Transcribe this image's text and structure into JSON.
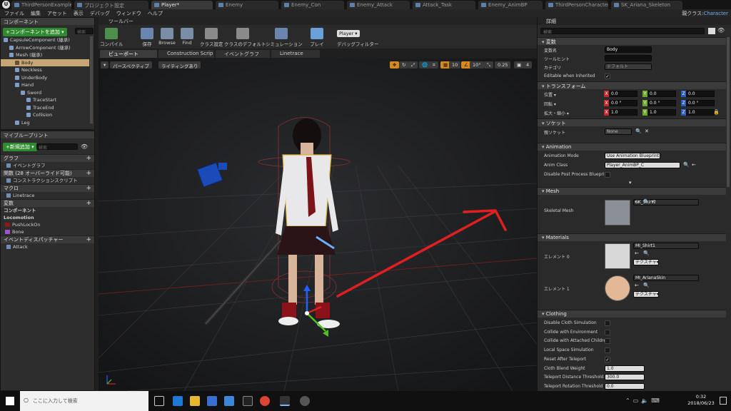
{
  "tabs": [
    {
      "label": "ThirdPersonExampleMap*",
      "active": false
    },
    {
      "label": "プロジェクト設定",
      "active": false
    },
    {
      "label": "Player*",
      "active": true
    },
    {
      "label": "Enemy",
      "active": false
    },
    {
      "label": "Enemy_Con",
      "active": false
    },
    {
      "label": "Enemy_Attack",
      "active": false
    },
    {
      "label": "Attack_Task",
      "active": false
    },
    {
      "label": "Enemy_AnimBP",
      "active": false
    },
    {
      "label": "ThirdPersonCharacter",
      "active": false
    },
    {
      "label": "SK_Ariana_Skeleton",
      "active": false
    }
  ],
  "menu": [
    "ファイル",
    "編集",
    "アセット",
    "表示",
    "デバッグ",
    "ウィンドウ",
    "ヘルプ"
  ],
  "parent_class": {
    "label": "親クラス:",
    "value": "Character"
  },
  "components": {
    "title": "コンポーネント",
    "add_button": "+コンポーネントを追加 ▾",
    "search_placeholder": "検索",
    "tree": [
      {
        "label": "CapsuleComponent (継承)",
        "indent": 0,
        "selected": false
      },
      {
        "label": "ArrowComponent (継承)",
        "indent": 1,
        "selected": false
      },
      {
        "label": "Mesh (継承)",
        "indent": 1,
        "selected": false
      },
      {
        "label": "Body",
        "indent": 2,
        "selected": true
      },
      {
        "label": "Neckless",
        "indent": 2,
        "selected": false
      },
      {
        "label": "UnderBody",
        "indent": 2,
        "selected": false
      },
      {
        "label": "Hand",
        "indent": 2,
        "selected": false
      },
      {
        "label": "Sword",
        "indent": 3,
        "selected": false
      },
      {
        "label": "TraceStart",
        "indent": 4,
        "selected": false
      },
      {
        "label": "TraceEnd",
        "indent": 4,
        "selected": false
      },
      {
        "label": "Collision",
        "indent": 4,
        "selected": false
      },
      {
        "label": "Leg",
        "indent": 2,
        "selected": false
      }
    ]
  },
  "myblueprint": {
    "title": "マイブループリント",
    "add_button": "+新規追加 ▾",
    "search_placeholder": "検索",
    "sections": [
      {
        "type": "cat",
        "label": "グラフ"
      },
      {
        "type": "item",
        "label": "イベントグラフ"
      },
      {
        "type": "cat",
        "label": "関数 (28 オーバーライド可能)"
      },
      {
        "type": "item",
        "label": "コンストラクションスクリプト"
      },
      {
        "type": "cat",
        "label": "マクロ"
      },
      {
        "type": "item",
        "label": "Linetrace"
      },
      {
        "type": "cat",
        "label": "変数"
      },
      {
        "type": "sub",
        "label": "コンポーネント"
      },
      {
        "type": "sub",
        "label": "Locomotion"
      },
      {
        "type": "var",
        "label": "PushLockOn",
        "color": "#8b1a1a"
      },
      {
        "type": "var",
        "label": "Bone",
        "color": "#a050d0"
      },
      {
        "type": "cat",
        "label": "イベントディスパッチャー"
      },
      {
        "type": "item",
        "label": "Attack"
      }
    ]
  },
  "toolbar": {
    "title": "ツールバー",
    "buttons": [
      "コンパイル",
      "保存",
      "Browse",
      "Find",
      "クラス設定",
      "クラスのデフォルト",
      "シミュレーション",
      "プレイ"
    ],
    "debug_select": "Player ▾",
    "debug_filter": "デバッグフィルター"
  },
  "view_tabs": [
    "ビューポート",
    "Construction Scrip",
    "イベントグラフ",
    "Linetrace"
  ],
  "viewport": {
    "perspective": "パースペクティブ",
    "lighting": "ライティングあり",
    "snap_grid": "10",
    "snap_rot": "10°",
    "snap_scale": "0.25",
    "camera_speed": "4"
  },
  "details": {
    "title": "詳細",
    "search_placeholder": "検索",
    "variable": {
      "cat": "変数",
      "name_label": "変数名",
      "name_value": "Body",
      "tooltip_label": "ツールヒント",
      "tooltip_value": "",
      "category_label": "カテゴリ",
      "category_value": "デフォルト",
      "editable_label": "Editable when Inherited"
    },
    "transform": {
      "cat": "トランスフォーム",
      "location_label": "位置 ▾",
      "location": [
        "0.0",
        "0.0",
        "0.0"
      ],
      "rotation_label": "回転 ▾",
      "rotation": [
        "0.0 °",
        "0.0 °",
        "0.0 °"
      ],
      "scale_label": "拡大・縮小 ▾",
      "scale": [
        "1.0",
        "1.0",
        "1.0"
      ]
    },
    "socket": {
      "cat": "ソケット",
      "label": "親ソケット",
      "value": "None"
    },
    "animation": {
      "cat": "Animation",
      "mode_label": "Animation Mode",
      "mode_value": "Use Animation Blueprint",
      "class_label": "Anim Class",
      "class_value": "Player_AnimBP_C",
      "disable_label": "Disable Post Process Blueprint"
    },
    "mesh": {
      "cat": "Mesh",
      "label": "Skeletal Mesh",
      "value": "SK_Shirt1"
    },
    "materials": {
      "cat": "Materials",
      "items": [
        {
          "label": "エレメント 0",
          "value": "MI_Shirt1",
          "tex": "テクスチャ▾"
        },
        {
          "label": "エレメント 1",
          "value": "MI_ArianaSkin",
          "tex": "テクスチャ▾"
        }
      ]
    },
    "clothing": {
      "cat": "Clothing",
      "rows": [
        {
          "label": "Disable Cloth Simulation",
          "kind": "check",
          "checked": false
        },
        {
          "label": "Collide with Environment",
          "kind": "check",
          "checked": false
        },
        {
          "label": "Collide with Attached Children",
          "kind": "check",
          "checked": false
        },
        {
          "label": "Local Space Simulation",
          "kind": "check",
          "checked": false
        },
        {
          "label": "Reset After Teleport",
          "kind": "check",
          "checked": true
        },
        {
          "label": "Cloth Blend Weight",
          "kind": "num",
          "value": "1.0"
        },
        {
          "label": "Teleport Distance Threshold",
          "kind": "num",
          "value": "300.0"
        },
        {
          "label": "Teleport Rotation Threshold",
          "kind": "num",
          "value": "0.0"
        }
      ]
    }
  },
  "taskbar": {
    "search_placeholder": "ここに入力して検索",
    "time": "0:32",
    "date": "2018/06/23"
  },
  "colors": {
    "accent_green": "#2f8a2f",
    "selected_row": "#c7a574",
    "arrow_red": "#e02020"
  }
}
